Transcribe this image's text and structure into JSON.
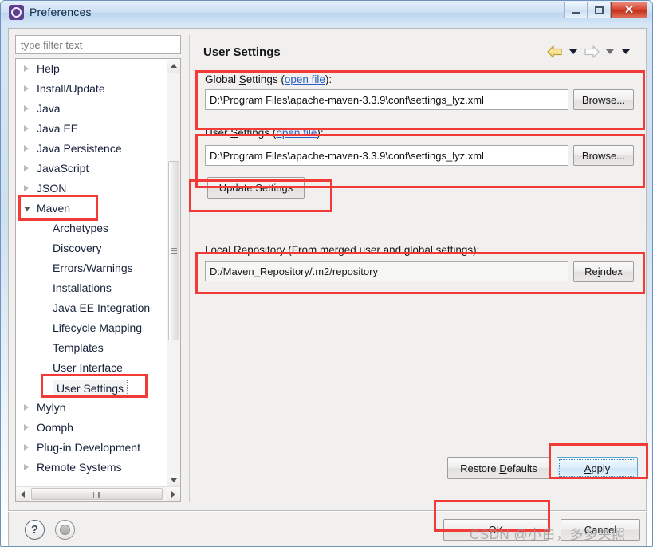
{
  "window": {
    "title": "Preferences",
    "icon": "preferences-gear-icon",
    "controls": {
      "minimize": "minimize-button",
      "maximize": "maximize-button",
      "close_label": "✕"
    }
  },
  "sidebar": {
    "filter": {
      "placeholder": "type filter text",
      "value": ""
    },
    "items": [
      {
        "label": "Help",
        "level": 0,
        "state": "collapsed",
        "selected": false
      },
      {
        "label": "Install/Update",
        "level": 0,
        "state": "collapsed",
        "selected": false
      },
      {
        "label": "Java",
        "level": 0,
        "state": "collapsed",
        "selected": false
      },
      {
        "label": "Java EE",
        "level": 0,
        "state": "collapsed",
        "selected": false
      },
      {
        "label": "Java Persistence",
        "level": 0,
        "state": "collapsed",
        "selected": false
      },
      {
        "label": "JavaScript",
        "level": 0,
        "state": "collapsed",
        "selected": false
      },
      {
        "label": "JSON",
        "level": 0,
        "state": "collapsed",
        "selected": false
      },
      {
        "label": "Maven",
        "level": 0,
        "state": "expanded",
        "selected": false
      },
      {
        "label": "Archetypes",
        "level": 1,
        "state": "leaf",
        "selected": false
      },
      {
        "label": "Discovery",
        "level": 1,
        "state": "leaf",
        "selected": false
      },
      {
        "label": "Errors/Warnings",
        "level": 1,
        "state": "leaf",
        "selected": false
      },
      {
        "label": "Installations",
        "level": 1,
        "state": "leaf",
        "selected": false
      },
      {
        "label": "Java EE Integration",
        "level": 1,
        "state": "leaf",
        "selected": false
      },
      {
        "label": "Lifecycle Mapping",
        "level": 1,
        "state": "leaf",
        "selected": false
      },
      {
        "label": "Templates",
        "level": 1,
        "state": "leaf",
        "selected": false
      },
      {
        "label": "User Interface",
        "level": 1,
        "state": "leaf",
        "selected": false
      },
      {
        "label": "User Settings",
        "level": 1,
        "state": "leaf",
        "selected": true
      },
      {
        "label": "Mylyn",
        "level": 0,
        "state": "collapsed",
        "selected": false
      },
      {
        "label": "Oomph",
        "level": 0,
        "state": "collapsed",
        "selected": false
      },
      {
        "label": "Plug-in Development",
        "level": 0,
        "state": "collapsed",
        "selected": false
      },
      {
        "label": "Remote Systems",
        "level": 0,
        "state": "collapsed",
        "selected": false
      }
    ]
  },
  "page": {
    "title": "User Settings",
    "nav": {
      "back_icon": "back-arrow-icon",
      "back_menu_icon": "chevron-down-icon",
      "forward_icon": "forward-arrow-icon",
      "forward_menu_icon": "chevron-down-icon",
      "menu_icon": "chevron-down-icon"
    },
    "global_settings": {
      "label_prefix": "Global ",
      "label_mnemonic": "S",
      "label_rest": "ettings (",
      "link": "open file",
      "label_suffix": "):",
      "value": "D:\\Program Files\\apache-maven-3.3.9\\conf\\settings_lyz.xml",
      "browse_label": "Browse..."
    },
    "user_settings": {
      "label_prefix": "User ",
      "label_mnemonic": "S",
      "label_rest": "ettings (",
      "link": "open file",
      "label_suffix": "):",
      "value": "D:\\Program Files\\apache-maven-3.3.9\\conf\\settings_lyz.xml",
      "browse_label": "Browse..."
    },
    "update_settings_label": "Update Settings",
    "local_repository": {
      "label": "Local Repository (From merged user and global settings):",
      "value": "D:/Maven_Repository/.m2/repository",
      "reindex_prefix": "Re",
      "reindex_mnemonic": "i",
      "reindex_rest": "ndex"
    },
    "restore_defaults": {
      "prefix": "Restore ",
      "mnemonic": "D",
      "rest": "efaults"
    },
    "apply": {
      "prefix": "",
      "mnemonic": "A",
      "rest": "pply"
    }
  },
  "footer": {
    "help_icon": "help-question-icon",
    "apply_close_icon": "apply-and-close-icon",
    "ok_label": "OK",
    "cancel_label": "Cancel"
  },
  "watermark": "CSDN @小白，多多关照",
  "colors": {
    "annotation": "#f23b36",
    "link": "#2760c4",
    "title_bar": "#cfe0f4",
    "close_button": "#d6422c",
    "panel_bg": "#f1f0ef"
  }
}
